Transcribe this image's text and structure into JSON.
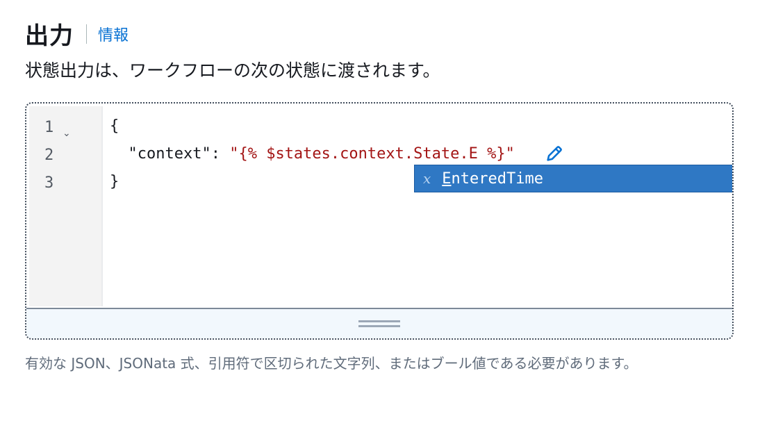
{
  "header": {
    "title": "出力",
    "info_link": "情報"
  },
  "description": "状態出力は、ワークフローの次の状態に渡されます。",
  "editor": {
    "lines": [
      {
        "number": "1",
        "text": "{"
      },
      {
        "number": "2",
        "key": "\"context\"",
        "colon": ": ",
        "value": "\"{% $states.context.State.E %}\""
      },
      {
        "number": "3",
        "text": "}"
      }
    ],
    "autocomplete": {
      "kind_icon": "x",
      "match": "E",
      "rest": "nteredTime"
    }
  },
  "hint": "有効な JSON、JSONata 式、引用符で区切られた文字列、またはブール値である必要があります。",
  "colors": {
    "accent": "#0972d3",
    "autocomplete_bg": "#2f78c4",
    "string": "#a31515"
  },
  "icons": [
    "chevron-down-icon",
    "pencil-icon",
    "variable-icon",
    "resize-handle-icon"
  ]
}
